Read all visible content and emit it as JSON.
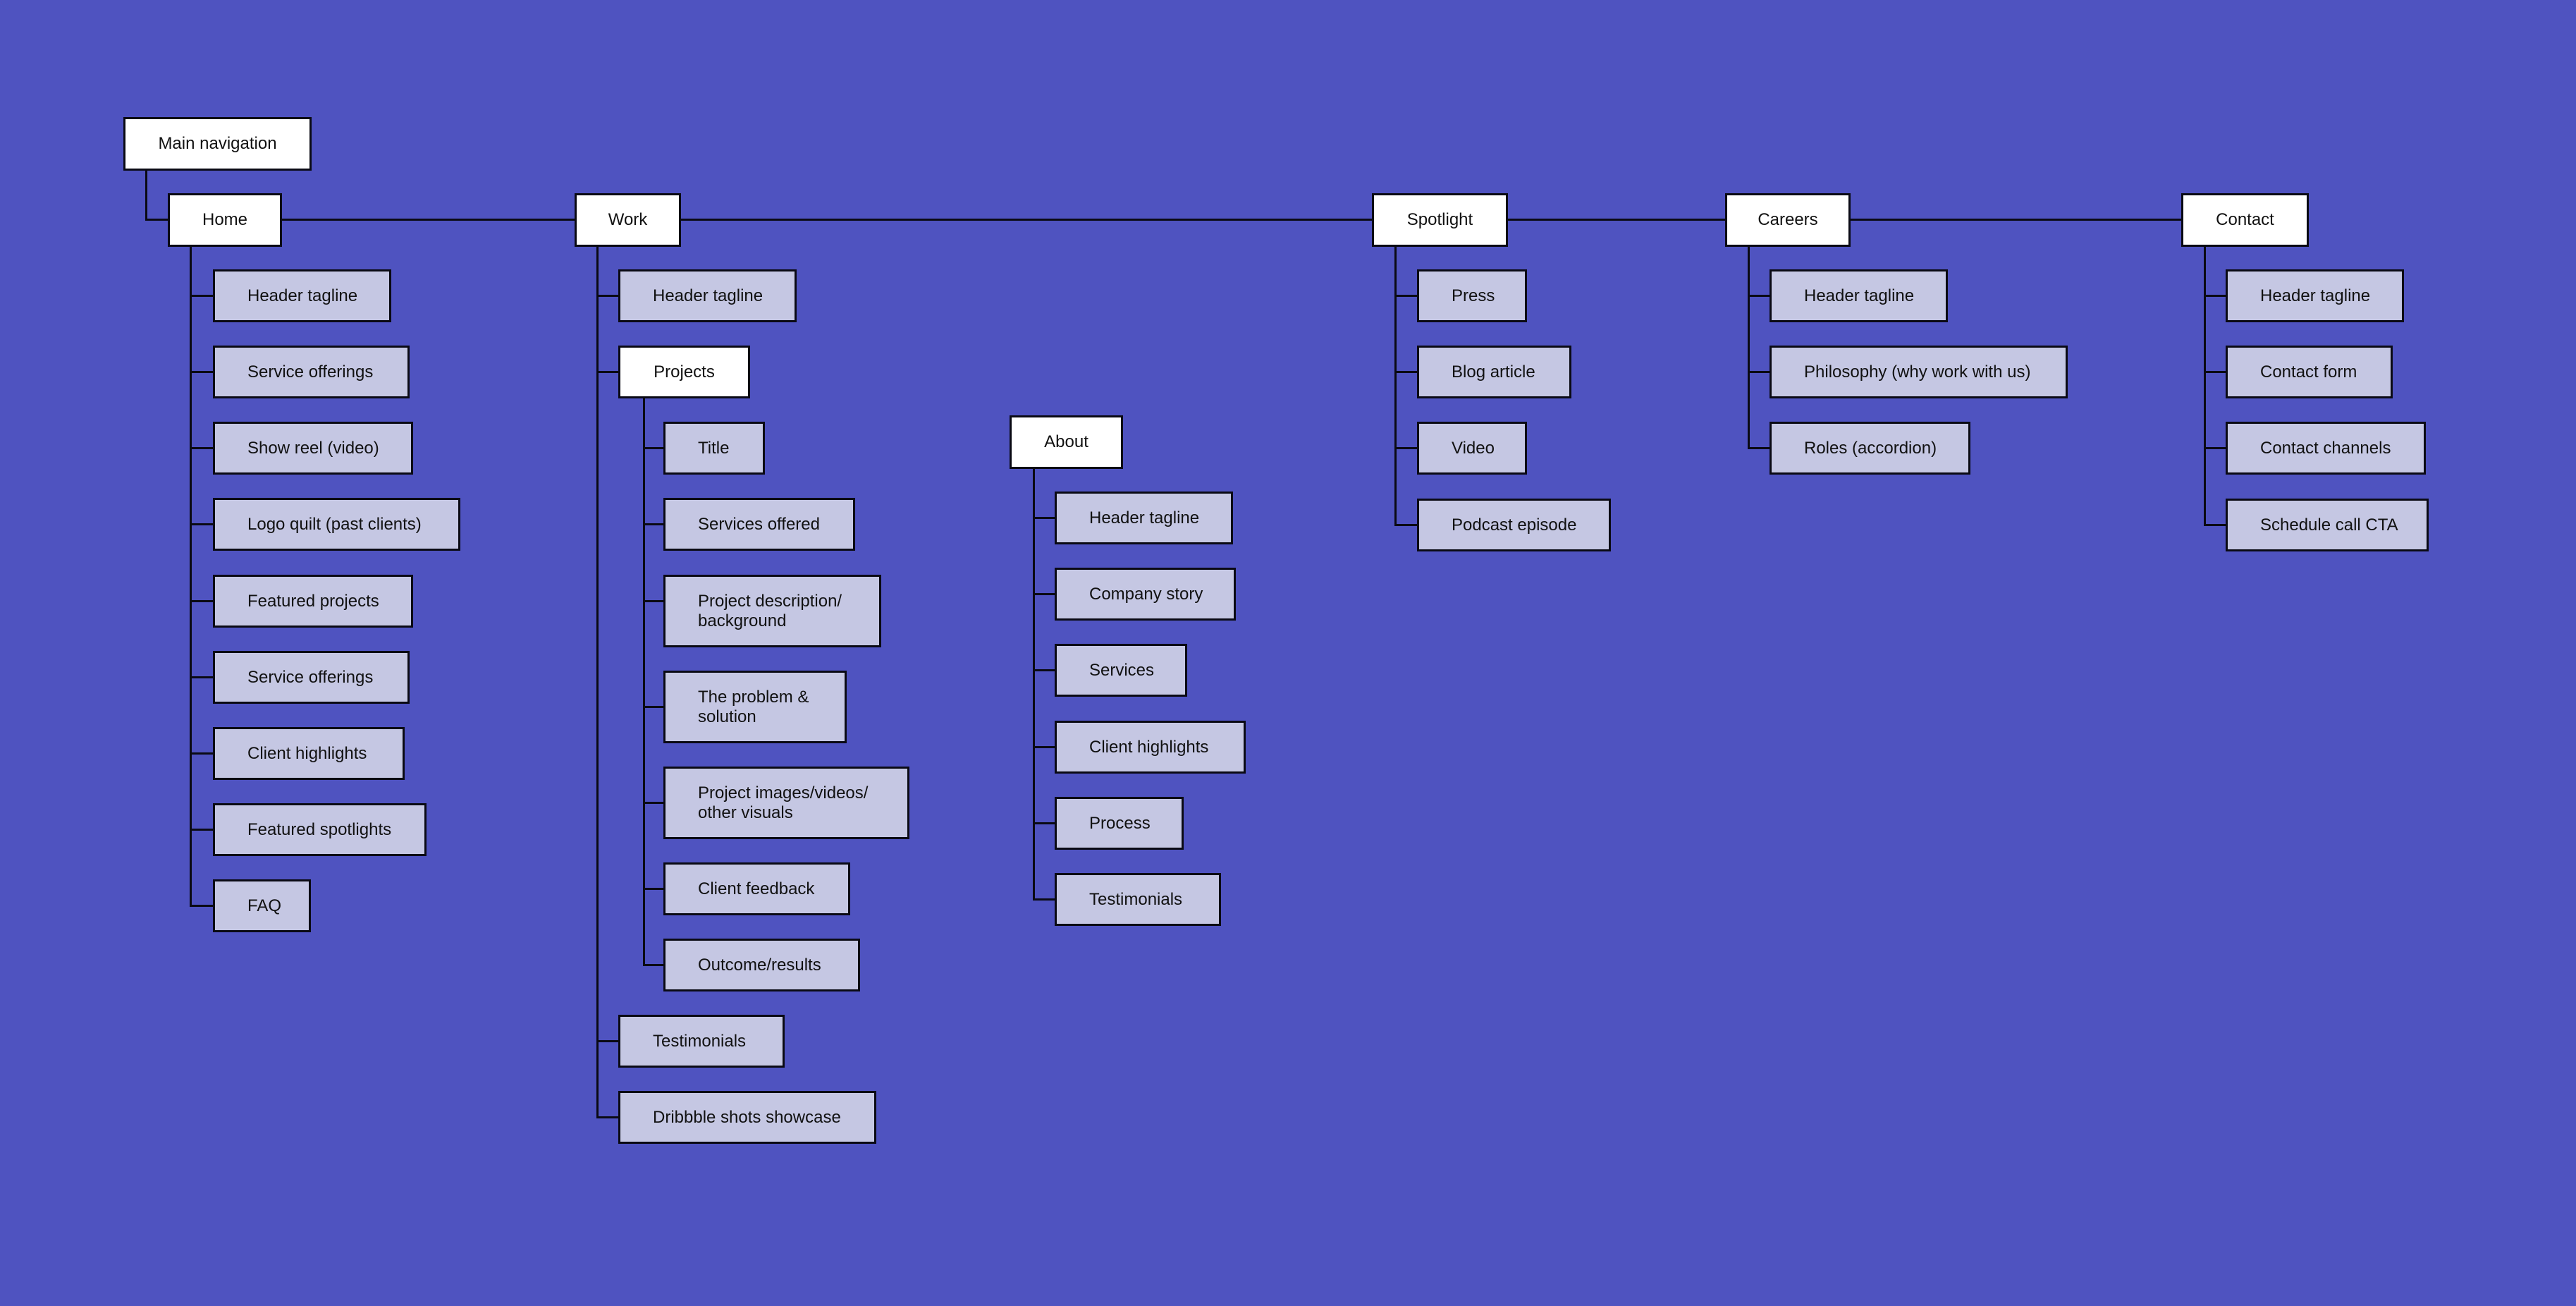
{
  "diagram": {
    "title": "Main navigation",
    "colors": {
      "background": "#4F53C0",
      "page_box": "#FFFFFF",
      "section_box": "#C5C7E3",
      "stroke": "#0A0A14"
    },
    "pages": [
      {
        "label": "Home",
        "children": [
          "Header tagline",
          "Service offerings",
          "Show reel (video)",
          "Logo quilt (past clients)",
          "Featured projects",
          "Service offerings",
          "Client highlights",
          "Featured spotlights",
          "FAQ"
        ]
      },
      {
        "label": "Work",
        "children": [
          "Header tagline",
          {
            "label": "Projects",
            "children": [
              "Title",
              "Services offered",
              "Project description/ background",
              "The problem & solution",
              "Project images/videos/ other visuals",
              "Client feedback",
              "Outcome/results"
            ]
          },
          "Testimonials",
          "Dribbble shots showcase"
        ]
      },
      {
        "label": "About",
        "children": [
          "Header tagline",
          "Company story",
          "Services",
          "Client highlights",
          "Process",
          "Testimonials"
        ]
      },
      {
        "label": "Spotlight",
        "children": [
          "Press",
          "Blog article",
          "Video",
          "Podcast episode"
        ]
      },
      {
        "label": "Careers",
        "children": [
          "Header tagline",
          "Philosophy (why work with us)",
          "Roles (accordion)"
        ]
      },
      {
        "label": "Contact",
        "children": [
          "Header tagline",
          "Contact form",
          "Contact channels",
          "Schedule call CTA"
        ]
      }
    ]
  }
}
